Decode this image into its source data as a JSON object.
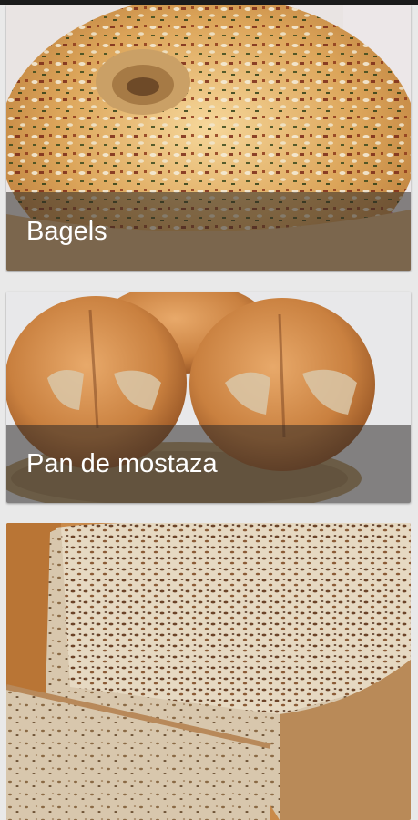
{
  "recipes": [
    {
      "title": "Bagels"
    },
    {
      "title": "Pan de mostaza"
    },
    {
      "title": ""
    }
  ]
}
